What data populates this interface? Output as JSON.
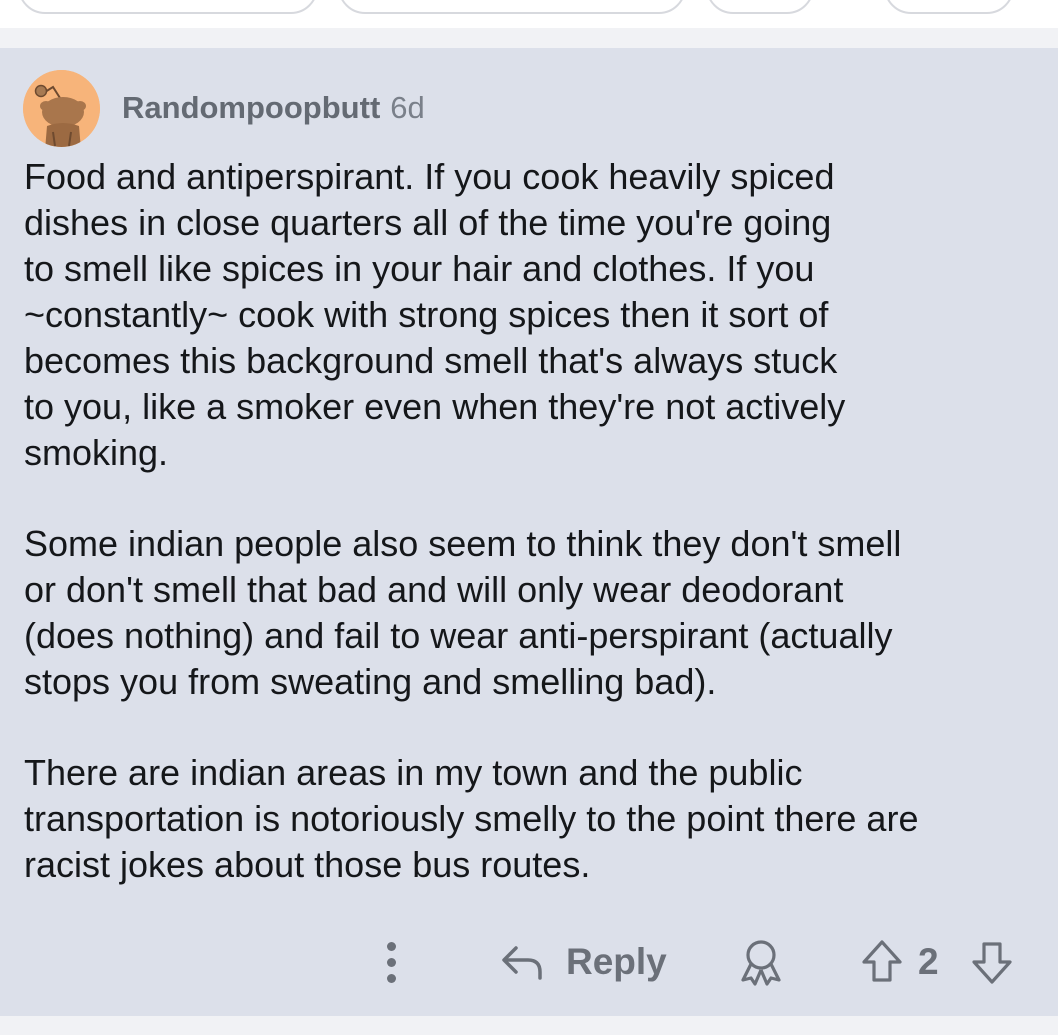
{
  "comment": {
    "author": "Randompoopbutt",
    "age": "6d",
    "paragraphs": [
      "Food and antiperspirant. If you cook heavily spiced\ndishes in close quarters all of the time you're going\nto smell like spices in your hair and clothes. If you\n~constantly~ cook with strong spices then it sort of\nbecomes this background smell that's always stuck\nto you, like a smoker even when they're not actively\nsmoking.",
      "Some indian people also seem to think they don't smell\nor don't smell that bad and will only wear deodorant\n(does nothing) and fail to wear anti-perspirant (actually\nstops you from sweating and smelling bad).",
      "There are indian areas in my town and the public\ntransportation is notoriously smelly to the point there are\nracist jokes about those bus routes."
    ],
    "actions": {
      "more_icon": "more-vertical-icon",
      "reply_icon": "reply-arrow-icon",
      "reply_label": "Reply",
      "award_icon": "award-icon",
      "upvote_icon": "upvote-arrow-icon",
      "score": "2",
      "downvote_icon": "downvote-arrow-icon"
    }
  },
  "colors": {
    "comment_background": "#dce0ea",
    "page_background": "#f1f2f5",
    "avatar_background": "#f7b47a",
    "text": "#15171a",
    "muted": "#6b7079"
  }
}
